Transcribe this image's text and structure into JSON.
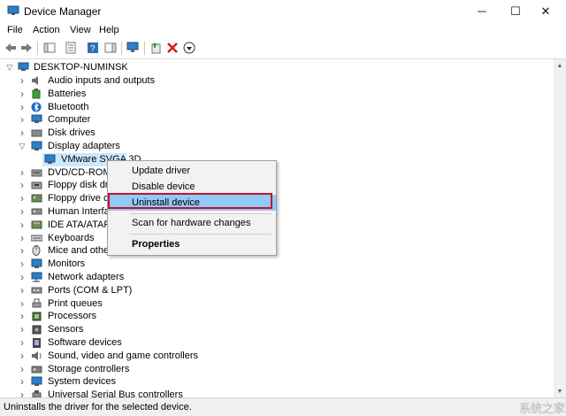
{
  "window": {
    "title": "Device Manager",
    "minimize": "─",
    "maximize": "☐",
    "close": "✕"
  },
  "menu": [
    "File",
    "Action",
    "View",
    "Help"
  ],
  "tree": {
    "root": "DESKTOP-NUMINSK",
    "items": [
      {
        "label": "Audio inputs and outputs",
        "icon": "speaker-icon"
      },
      {
        "label": "Batteries",
        "icon": "battery-icon"
      },
      {
        "label": "Bluetooth",
        "icon": "bluetooth-icon"
      },
      {
        "label": "Computer",
        "icon": "computer-icon"
      },
      {
        "label": "Disk drives",
        "icon": "disk-icon"
      },
      {
        "label": "Display adapters",
        "icon": "display-icon",
        "expanded": true
      },
      {
        "label": "VMware SVGA 3D",
        "icon": "display-icon",
        "child": true,
        "selected": true
      },
      {
        "label": "DVD/CD-ROM d",
        "icon": "dvd-icon"
      },
      {
        "label": "Floppy disk driv",
        "icon": "floppy-icon"
      },
      {
        "label": "Floppy drive co",
        "icon": "floppy-controller-icon"
      },
      {
        "label": "Human Interfac",
        "icon": "hid-icon"
      },
      {
        "label": "IDE ATA/ATAPI c",
        "icon": "ide-icon"
      },
      {
        "label": "Keyboards",
        "icon": "keyboard-icon"
      },
      {
        "label": "Mice and other",
        "icon": "mouse-icon"
      },
      {
        "label": "Monitors",
        "icon": "monitor-icon"
      },
      {
        "label": "Network adapters",
        "icon": "network-icon"
      },
      {
        "label": "Ports (COM & LPT)",
        "icon": "port-icon"
      },
      {
        "label": "Print queues",
        "icon": "printer-icon"
      },
      {
        "label": "Processors",
        "icon": "cpu-icon"
      },
      {
        "label": "Sensors",
        "icon": "sensor-icon"
      },
      {
        "label": "Software devices",
        "icon": "software-icon"
      },
      {
        "label": "Sound, video and game controllers",
        "icon": "sound-icon"
      },
      {
        "label": "Storage controllers",
        "icon": "storage-icon"
      },
      {
        "label": "System devices",
        "icon": "system-icon"
      },
      {
        "label": "Universal Serial Bus controllers",
        "icon": "usb-icon"
      }
    ]
  },
  "context_menu": {
    "items": [
      "Update driver",
      "Disable device",
      "Uninstall device",
      "Scan for hardware changes",
      "Properties"
    ],
    "highlighted": "Uninstall device"
  },
  "status": "Uninstalls the driver for the selected device.",
  "watermark": "系统之家",
  "colors": {
    "selection": "#cce8ff",
    "menu_highlight": "#91c9f7",
    "red_outline": "#c8102e"
  }
}
